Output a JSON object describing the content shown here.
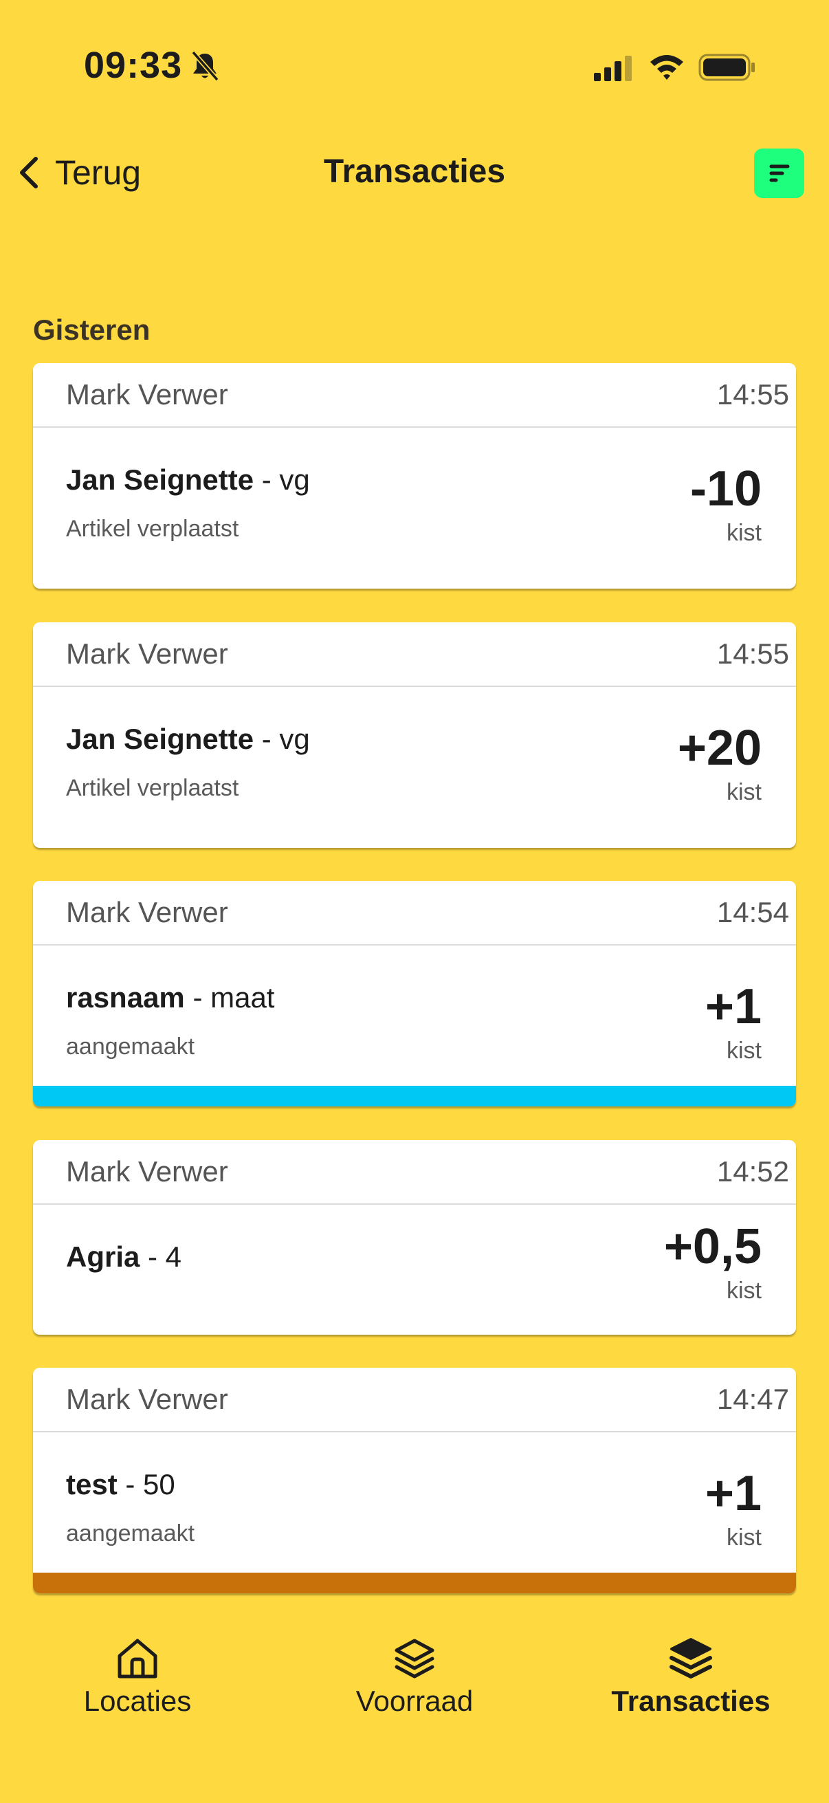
{
  "status_bar": {
    "time": "09:33",
    "icons": [
      "bell-slash-icon",
      "cellular-signal-icon",
      "wifi-icon",
      "battery-icon"
    ]
  },
  "nav": {
    "back_label": "Terug",
    "title": "Transacties",
    "filter_icon": "filter-icon",
    "filter_color": "#1EFF7E"
  },
  "colors": {
    "background": "#FFD940",
    "stripe_blue": "#00C8F5",
    "stripe_orange": "#C8700A"
  },
  "section": {
    "title": "Gisteren"
  },
  "transactions": [
    {
      "user": "Mark Verwer",
      "time": "14:55",
      "product": "Jan Seignette",
      "variant": "- vg",
      "action": "Artikel verplaatst",
      "amount": "-10",
      "unit": "kist"
    },
    {
      "user": "Mark Verwer",
      "time": "14:55",
      "product": "Jan Seignette",
      "variant": "- vg",
      "action": "Artikel verplaatst",
      "amount": "+20",
      "unit": "kist"
    },
    {
      "user": "Mark Verwer",
      "time": "14:54",
      "product": "rasnaam",
      "variant": "- maat",
      "action": "aangemaakt",
      "amount": "+1",
      "unit": "kist",
      "stripe": "#00C8F5"
    },
    {
      "user": "Mark Verwer",
      "time": "14:52",
      "product": "Agria",
      "variant": "- 4",
      "action": "",
      "amount": "+0,5",
      "unit": "kist"
    },
    {
      "user": "Mark Verwer",
      "time": "14:47",
      "product": "test",
      "variant": "- 50",
      "action": "aangemaakt",
      "amount": "+1",
      "unit": "kist",
      "stripe": "#C8700A"
    }
  ],
  "tabs": [
    {
      "label": "Locaties",
      "icon": "home-icon",
      "active": false
    },
    {
      "label": "Voorraad",
      "icon": "layers-icon",
      "active": false
    },
    {
      "label": "Transacties",
      "icon": "stack-icon",
      "active": true
    }
  ]
}
